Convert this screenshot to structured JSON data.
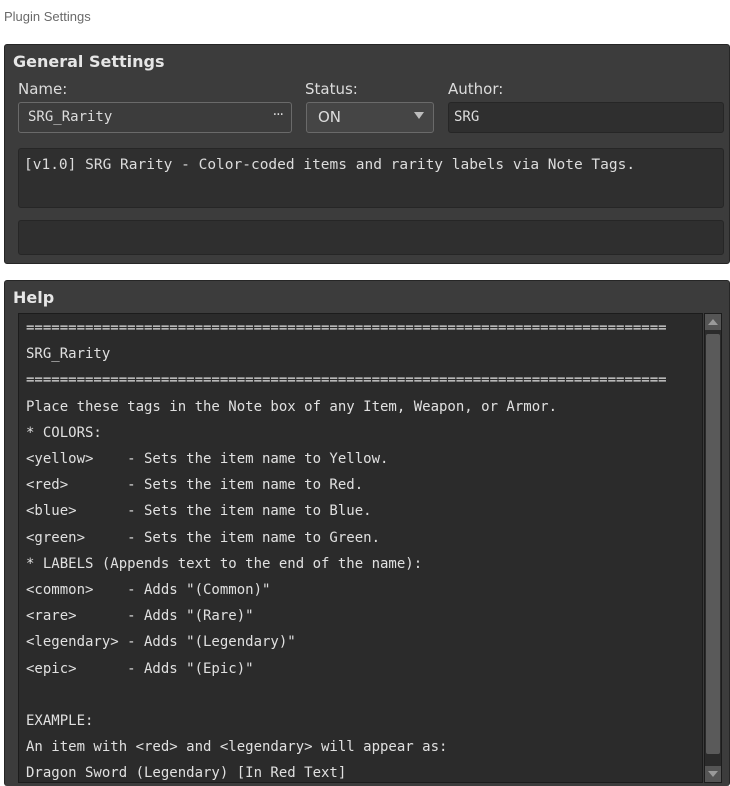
{
  "window": {
    "title": "Plugin Settings"
  },
  "general": {
    "title": "General Settings",
    "name_label": "Name:",
    "name_value": "SRG_Rarity",
    "name_button": "···",
    "status_label": "Status:",
    "status_value": "ON",
    "author_label": "Author:",
    "author_value": "SRG",
    "description": "[v1.0] SRG Rarity - Color-coded items and rarity labels via Note Tags.",
    "extra_value": ""
  },
  "help": {
    "title": "Help",
    "lines": [
      "============================================================================",
      "SRG_Rarity",
      "============================================================================",
      "Place these tags in the Note box of any Item, Weapon, or Armor.",
      "* COLORS:",
      "<yellow>    - Sets the item name to Yellow.",
      "<red>       - Sets the item name to Red.",
      "<blue>      - Sets the item name to Blue.",
      "<green>     - Sets the item name to Green.",
      "* LABELS (Appends text to the end of the name):",
      "<common>    - Adds \"(Common)\"",
      "<rare>      - Adds \"(Rare)\"",
      "<legendary> - Adds \"(Legendary)\"",
      "<epic>      - Adds \"(Epic)\"",
      "",
      "EXAMPLE:",
      "An item with <red> and <legendary> will appear as:",
      "Dragon Sword (Legendary) [In Red Text]"
    ]
  }
}
